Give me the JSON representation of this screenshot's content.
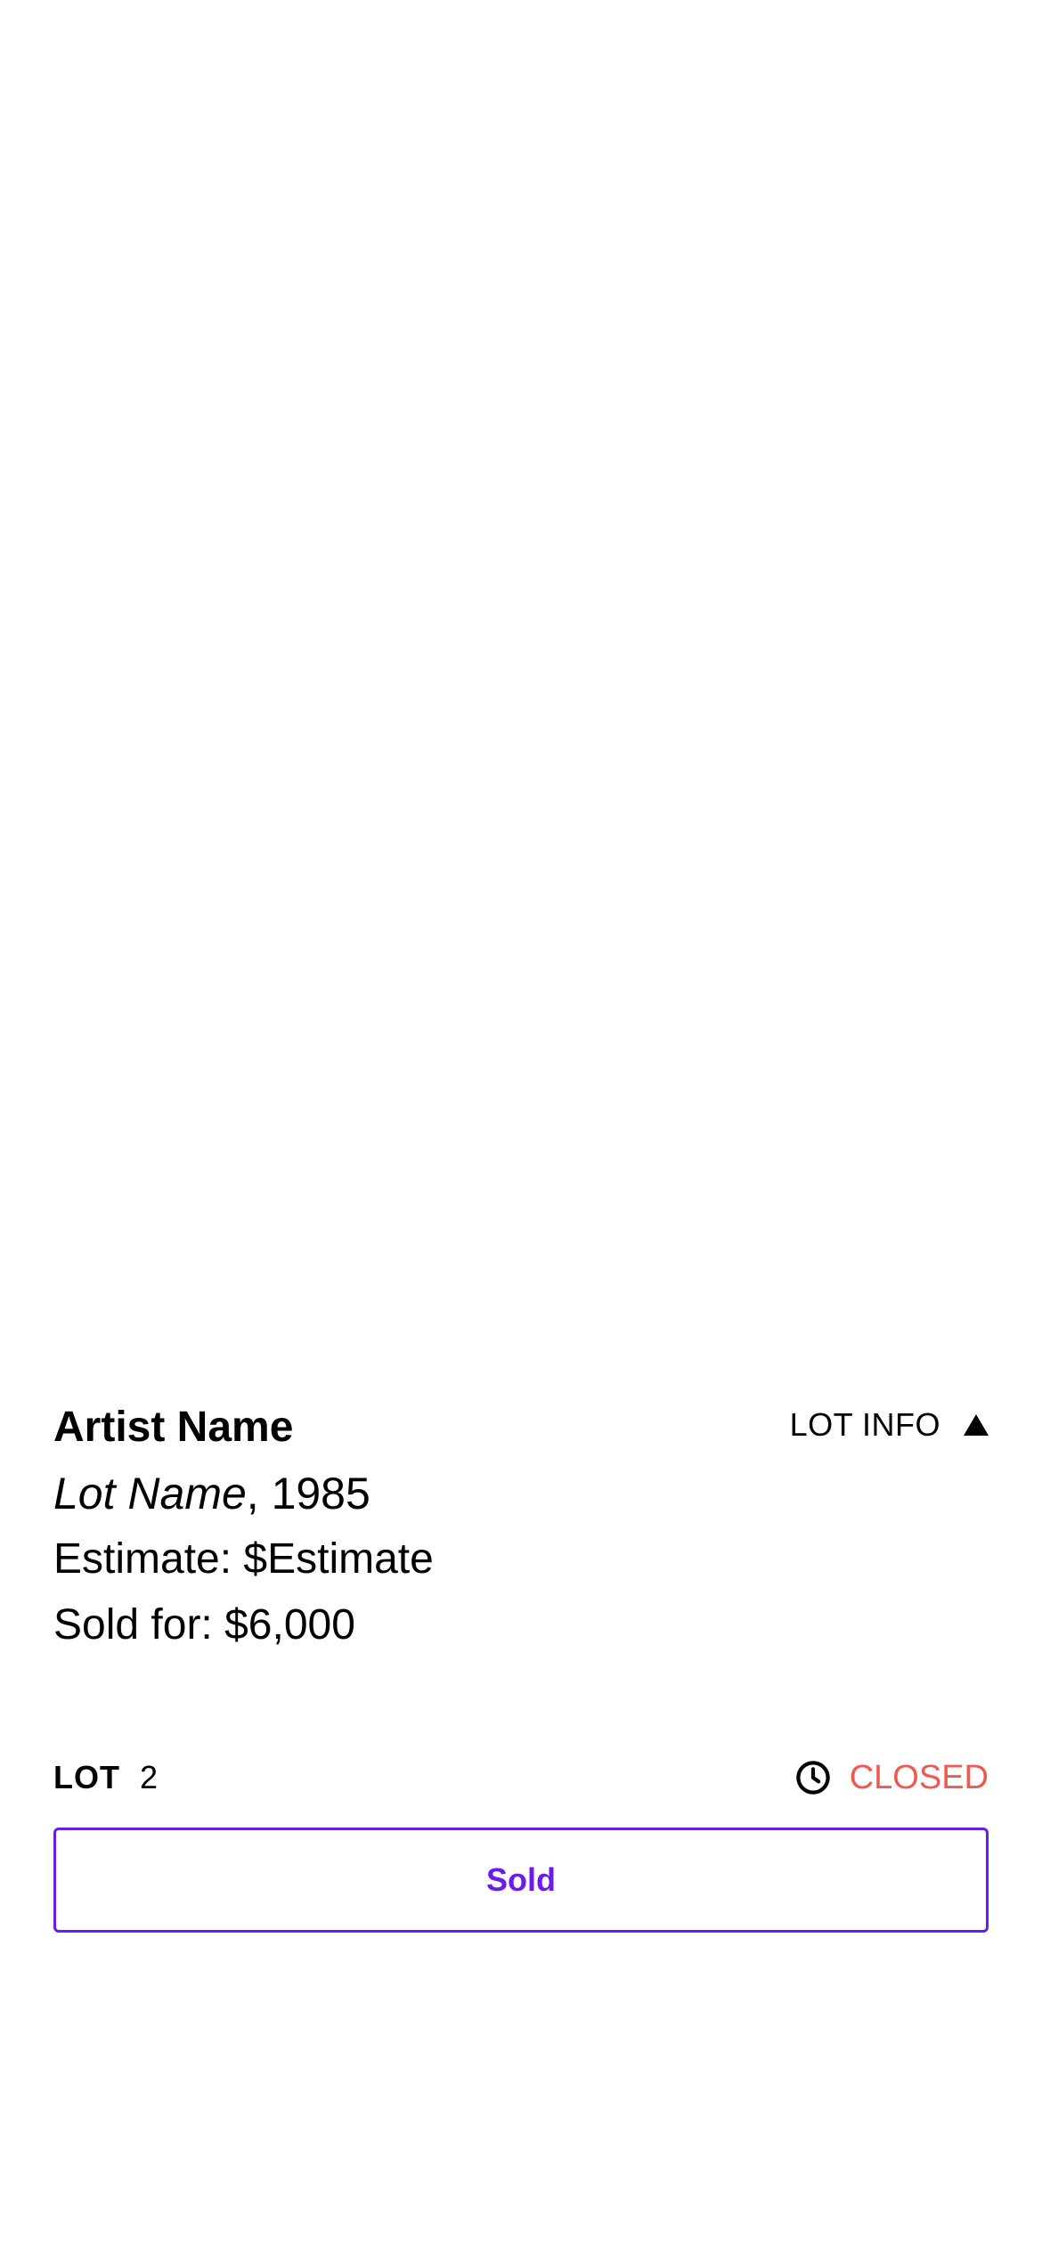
{
  "lot": {
    "artist_name": "Artist Name",
    "lot_name": "Lot Name",
    "year_suffix": ", 1985",
    "estimate": "Estimate: $Estimate",
    "sold_for": "Sold for: $6,000",
    "lot_label": "LOT",
    "lot_number": "2"
  },
  "lot_info_toggle": {
    "label": "LOT INFO",
    "icon": "triangle-up-icon"
  },
  "status": {
    "icon": "clock-icon",
    "label": "CLOSED",
    "color": "#EE5A4F"
  },
  "action": {
    "label": "Sold",
    "color": "#6A1BF0"
  }
}
